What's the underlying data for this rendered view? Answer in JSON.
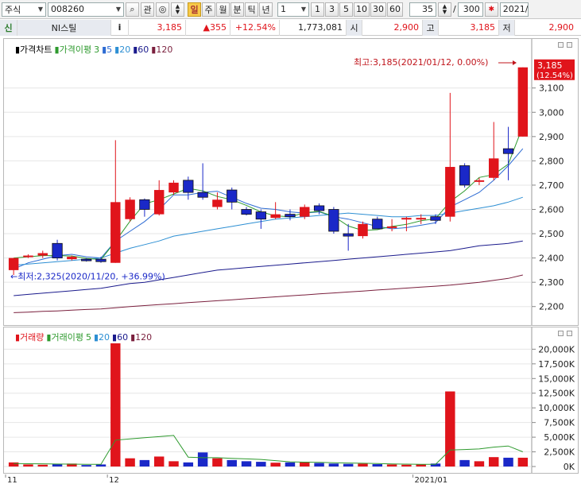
{
  "toolbar": {
    "market": "주식",
    "code": "008260",
    "btn_search": "⌕",
    "btn_kwan": "관",
    "periods": [
      "일",
      "주",
      "월",
      "분",
      "틱",
      "년"
    ],
    "interval_value": "1",
    "minute_buttons": [
      "1",
      "3",
      "5",
      "10",
      "30",
      "60"
    ],
    "count_value": "35",
    "slash": "/",
    "total_value": "300",
    "date_value": "2021/"
  },
  "quote": {
    "badge": "신",
    "name": "NI스틸",
    "info": "i",
    "price": "3,185",
    "change": "▲355",
    "rate": "+12.54%",
    "volume": "1,773,081",
    "open_label": "시",
    "open": "2,900",
    "high_label": "고",
    "high": "3,185",
    "low_label": "저",
    "low": "2,900"
  },
  "price_panel": {
    "legend": [
      {
        "text": "▮가격차트",
        "color": "#000000"
      },
      {
        "text": "▮가격이평",
        "color": "#2e9a2e"
      },
      {
        "text": "3",
        "color": "#2e9a2e"
      },
      {
        "text": "▮5",
        "color": "#2d6bd3"
      },
      {
        "text": "▮20",
        "color": "#2d8fd3"
      },
      {
        "text": "▮60",
        "color": "#1a1a8c"
      },
      {
        "text": "▮120",
        "color": "#7a1f3d"
      }
    ],
    "high_note": "최고:3,185(2021/01/12, 0.00%)",
    "low_note": "←최저:2,325(2020/11/20, +36.99%)",
    "last_price": "3,185",
    "last_rate": "(12.54%)",
    "y_ticks": [
      "3,100",
      "3,000",
      "2,900",
      "2,800",
      "2,700",
      "2,600",
      "2,500",
      "2,400",
      "2,300",
      "2,200"
    ],
    "y_min": 2150,
    "y_max": 3230
  },
  "volume_panel": {
    "legend": [
      {
        "text": "▮거래량",
        "color": "#e0141b"
      },
      {
        "text": "▮거래이평",
        "color": "#2e9a2e"
      },
      {
        "text": "5",
        "color": "#2e9a2e"
      },
      {
        "text": "▮20",
        "color": "#2d8fd3"
      },
      {
        "text": "▮60",
        "color": "#1a1a8c"
      },
      {
        "text": "▮120",
        "color": "#7a1f3d"
      }
    ],
    "y_ticks": [
      "20,000K",
      "17,500K",
      "15,000K",
      "12,500K",
      "10,000K",
      "7,500K",
      "5,000K",
      "2,500K",
      "0K"
    ],
    "y_max": 21000
  },
  "x_labels": [
    {
      "text": "11",
      "index": 0
    },
    {
      "text": "12",
      "index": 7
    },
    {
      "text": "2021/01",
      "index": 28
    }
  ],
  "colors": {
    "up": "#e0141b",
    "down": "#1a28c8"
  },
  "chart_data": {
    "type": "candlestick",
    "candles": [
      {
        "o": 2350,
        "h": 2400,
        "l": 2330,
        "c": 2400
      },
      {
        "o": 2405,
        "h": 2415,
        "l": 2400,
        "c": 2410
      },
      {
        "o": 2410,
        "h": 2430,
        "l": 2400,
        "c": 2420
      },
      {
        "o": 2460,
        "h": 2475,
        "l": 2390,
        "c": 2400
      },
      {
        "o": 2395,
        "h": 2410,
        "l": 2390,
        "c": 2405
      },
      {
        "o": 2395,
        "h": 2400,
        "l": 2385,
        "c": 2390
      },
      {
        "o": 2395,
        "h": 2405,
        "l": 2380,
        "c": 2385
      },
      {
        "o": 2380,
        "h": 2885,
        "l": 2380,
        "c": 2630
      },
      {
        "o": 2560,
        "h": 2650,
        "l": 2550,
        "c": 2640
      },
      {
        "o": 2640,
        "h": 2645,
        "l": 2570,
        "c": 2600
      },
      {
        "o": 2580,
        "h": 2720,
        "l": 2575,
        "c": 2680
      },
      {
        "o": 2670,
        "h": 2720,
        "l": 2660,
        "c": 2710
      },
      {
        "o": 2720,
        "h": 2735,
        "l": 2640,
        "c": 2670
      },
      {
        "o": 2670,
        "h": 2790,
        "l": 2640,
        "c": 2650
      },
      {
        "o": 2610,
        "h": 2670,
        "l": 2600,
        "c": 2640
      },
      {
        "o": 2680,
        "h": 2690,
        "l": 2600,
        "c": 2630
      },
      {
        "o": 2600,
        "h": 2610,
        "l": 2575,
        "c": 2580
      },
      {
        "o": 2590,
        "h": 2600,
        "l": 2520,
        "c": 2560
      },
      {
        "o": 2565,
        "h": 2630,
        "l": 2560,
        "c": 2580
      },
      {
        "o": 2580,
        "h": 2600,
        "l": 2555,
        "c": 2570
      },
      {
        "o": 2570,
        "h": 2620,
        "l": 2560,
        "c": 2610
      },
      {
        "o": 2615,
        "h": 2625,
        "l": 2580,
        "c": 2595
      },
      {
        "o": 2600,
        "h": 2610,
        "l": 2500,
        "c": 2510
      },
      {
        "o": 2500,
        "h": 2540,
        "l": 2430,
        "c": 2490
      },
      {
        "o": 2490,
        "h": 2550,
        "l": 2480,
        "c": 2540
      },
      {
        "o": 2560,
        "h": 2570,
        "l": 2520,
        "c": 2520
      },
      {
        "o": 2530,
        "h": 2560,
        "l": 2510,
        "c": 2530
      },
      {
        "o": 2560,
        "h": 2570,
        "l": 2510,
        "c": 2565
      },
      {
        "o": 2565,
        "h": 2580,
        "l": 2540,
        "c": 2565
      },
      {
        "o": 2570,
        "h": 2580,
        "l": 2540,
        "c": 2555
      },
      {
        "o": 2570,
        "h": 3080,
        "l": 2550,
        "c": 2775
      },
      {
        "o": 2780,
        "h": 2790,
        "l": 2690,
        "c": 2700
      },
      {
        "o": 2720,
        "h": 2730,
        "l": 2700,
        "c": 2720
      },
      {
        "o": 2730,
        "h": 2960,
        "l": 2720,
        "c": 2810
      },
      {
        "o": 2850,
        "h": 2940,
        "l": 2720,
        "c": 2830
      },
      {
        "o": 2900,
        "h": 3185,
        "l": 2900,
        "c": 3185
      }
    ],
    "volume": [
      700,
      350,
      300,
      400,
      500,
      250,
      350,
      21000,
      1400,
      1100,
      1700,
      900,
      700,
      2400,
      1400,
      1100,
      900,
      800,
      650,
      700,
      800,
      600,
      500,
      450,
      500,
      400,
      350,
      300,
      400,
      500,
      12800,
      1100,
      900,
      1600,
      1500,
      1500
    ],
    "ma_price": {
      "ma5": [
        2355,
        2380,
        2395,
        2410,
        2415,
        2405,
        2400,
        2470,
        2510,
        2550,
        2600,
        2660,
        2660,
        2670,
        2675,
        2650,
        2625,
        2605,
        2600,
        2590,
        2585,
        2590,
        2570,
        2560,
        2545,
        2530,
        2520,
        2525,
        2535,
        2545,
        2610,
        2640,
        2670,
        2720,
        2780,
        2850
      ],
      "ma20": [
        2370,
        2375,
        2380,
        2385,
        2390,
        2395,
        2400,
        2420,
        2440,
        2455,
        2470,
        2490,
        2500,
        2510,
        2520,
        2530,
        2540,
        2550,
        2560,
        2565,
        2570,
        2575,
        2580,
        2585,
        2580,
        2575,
        2570,
        2570,
        2575,
        2575,
        2585,
        2595,
        2605,
        2615,
        2630,
        2650
      ],
      "ma60": [
        2245,
        2250,
        2255,
        2260,
        2265,
        2270,
        2275,
        2285,
        2295,
        2300,
        2310,
        2320,
        2330,
        2340,
        2350,
        2355,
        2360,
        2365,
        2370,
        2375,
        2380,
        2385,
        2390,
        2395,
        2400,
        2405,
        2410,
        2415,
        2420,
        2425,
        2430,
        2440,
        2450,
        2455,
        2460,
        2470
      ],
      "ma120": [
        2175,
        2177,
        2180,
        2182,
        2185,
        2188,
        2190,
        2195,
        2200,
        2204,
        2208,
        2212,
        2216,
        2220,
        2224,
        2228,
        2232,
        2236,
        2240,
        2244,
        2248,
        2252,
        2256,
        2260,
        2264,
        2268,
        2272,
        2276,
        2280,
        2284,
        2288,
        2294,
        2300,
        2308,
        2316,
        2330
      ]
    },
    "ma_volume": {
      "ma5": [
        500,
        480,
        460,
        420,
        400,
        380,
        380,
        4500,
        4700,
        4900,
        5100,
        5300,
        1600,
        1500,
        1500,
        1400,
        1300,
        1200,
        1000,
        800,
        750,
        700,
        650,
        600,
        550,
        500,
        450,
        400,
        380,
        380,
        2800,
        2900,
        3000,
        3300,
        3500,
        2500
      ]
    }
  }
}
